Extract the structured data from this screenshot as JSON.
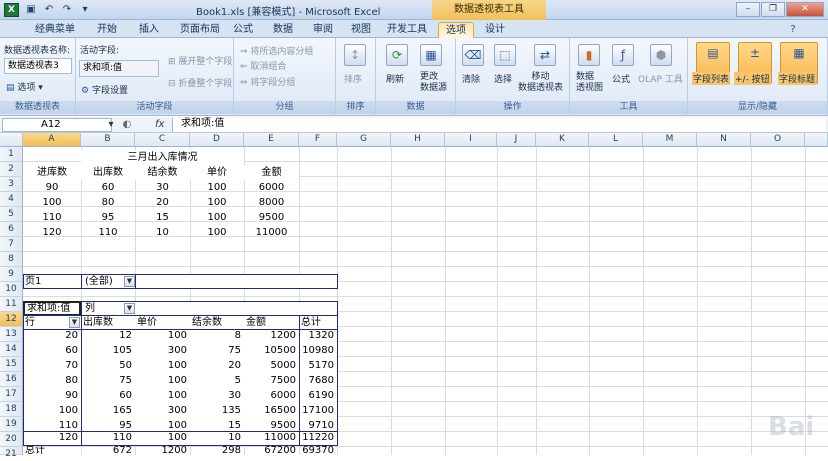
{
  "title": "Book1.xls  [兼容模式] - Microsoft Excel",
  "context_tool": "数据透视表工具",
  "app_icon": "X",
  "qat": {
    "save": "save-icon",
    "undo": "undo-icon",
    "redo": "redo-icon"
  },
  "tabs": [
    "经典菜单",
    "开始",
    "插入",
    "页面布局",
    "公式",
    "数据",
    "审阅",
    "视图",
    "开发工具",
    "选项",
    "设计"
  ],
  "active_tab": "选项",
  "ribbon": {
    "pivot_name_label": "数据透视表名称:",
    "pivot_name_value": "数据透视表3",
    "options_button": "选项",
    "group_pivot": "数据透视表",
    "active_field_label": "活动字段:",
    "active_field_value": "求和项:值",
    "field_settings": "字段设置",
    "expand_field": "展开整个字段",
    "collapse_field": "折叠整个字段",
    "group_active_field": "活动字段",
    "group_selection": "将所选内容分组",
    "ungroup": "取消组合",
    "group_field": "将字段分组",
    "group_group": "分组",
    "sort": "排序",
    "group_sort": "排序",
    "refresh": "刷新",
    "change_source": "更改\n数据源",
    "group_data": "数据",
    "clear": "清除",
    "select": "选择",
    "move_pivot": "移动\n数据透视表",
    "group_actions": "操作",
    "pivot_chart": "数据\n透视图",
    "formulas": "公式",
    "olap_tools": "OLAP 工具",
    "group_tools": "工具",
    "field_list": "字段列表",
    "plus_minus": "+/- 按钮",
    "field_headers": "字段标题",
    "group_showhide": "显示/隐藏"
  },
  "formula_bar": {
    "name_box": "A12",
    "fx": "fx",
    "formula": "求和项:值"
  },
  "columns": [
    "A",
    "B",
    "C",
    "D",
    "E",
    "F",
    "G",
    "H",
    "I",
    "J",
    "K",
    "L",
    "M",
    "N",
    "O"
  ],
  "selected_column": "A",
  "rows": [
    "1",
    "2",
    "3",
    "4",
    "5",
    "6",
    "7",
    "8",
    "9",
    "10",
    "11",
    "12",
    "13",
    "14",
    "15",
    "16",
    "17",
    "18",
    "19",
    "20",
    "21",
    "22"
  ],
  "selected_row": "12",
  "source_table": {
    "title": "三月出入库情况",
    "headers": [
      "进库数",
      "出库数",
      "结余数",
      "单价",
      "金额"
    ],
    "rows": [
      [
        "90",
        "60",
        "30",
        "100",
        "6000"
      ],
      [
        "100",
        "80",
        "20",
        "100",
        "8000"
      ],
      [
        "110",
        "95",
        "15",
        "100",
        "9500"
      ],
      [
        "120",
        "110",
        "10",
        "100",
        "11000"
      ]
    ]
  },
  "pivot": {
    "page_field": "页1",
    "page_value": "(全部)",
    "data_field": "求和项:值",
    "col_field": "列",
    "row_field": "行",
    "col_headers": [
      "出库数",
      "单价",
      "结余数",
      "金额",
      "总计"
    ],
    "rows": [
      [
        "20",
        "12",
        "100",
        "8",
        "1200",
        "1320"
      ],
      [
        "60",
        "105",
        "300",
        "75",
        "10500",
        "10980"
      ],
      [
        "70",
        "50",
        "100",
        "20",
        "5000",
        "5170"
      ],
      [
        "80",
        "75",
        "100",
        "5",
        "7500",
        "7680"
      ],
      [
        "90",
        "60",
        "100",
        "30",
        "6000",
        "6190"
      ],
      [
        "100",
        "165",
        "300",
        "135",
        "16500",
        "17100"
      ],
      [
        "110",
        "95",
        "100",
        "15",
        "9500",
        "9710"
      ],
      [
        "120",
        "110",
        "100",
        "10",
        "11000",
        "11220"
      ]
    ],
    "total_label": "总计",
    "totals": [
      "672",
      "1200",
      "298",
      "67200",
      "69370"
    ]
  },
  "watermark": "Bai"
}
